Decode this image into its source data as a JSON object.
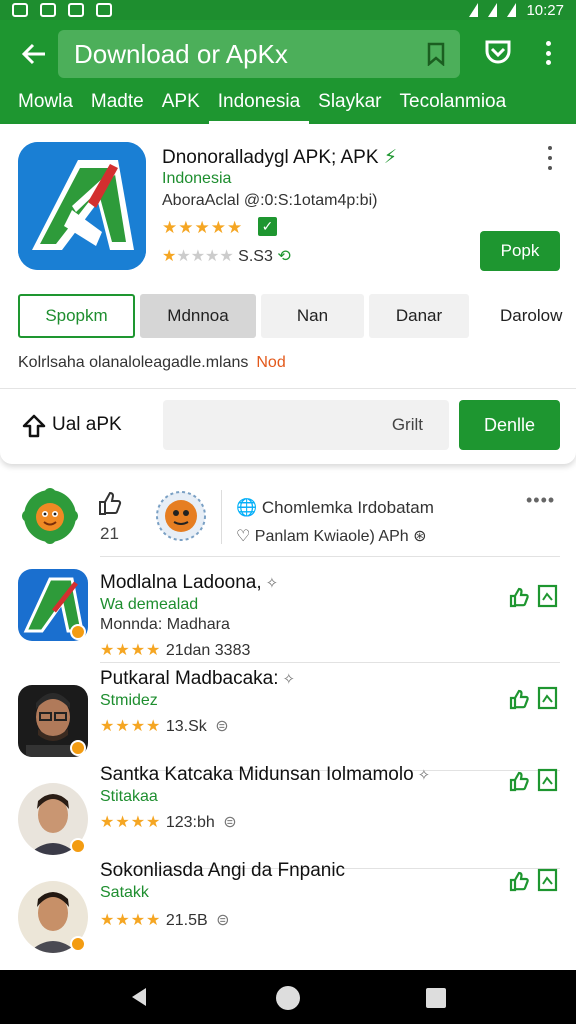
{
  "status_bar": {
    "time": "10:27"
  },
  "app_bar": {
    "search_text": "Download or ApKx",
    "tabs": [
      "Mowla",
      "Madte",
      "APK",
      "Indonesia",
      "Slaykar",
      "Tecolanmioa"
    ],
    "active_tab": 3
  },
  "featured": {
    "title": "Dnonoralladygl APK; APK",
    "subtitle": "Indonesia",
    "developer": "AboraAclal @:0:S:1otam4p:bi)",
    "rating_count": "S.S3",
    "install_label": "Popk",
    "chips": [
      "Spopkm",
      "Mdnnoa",
      "Nan",
      "Danar",
      "Darolow"
    ],
    "info_text": "Kolrlsaha olanaloleagadle.mlans",
    "info_new": "Nod",
    "share_label": "Ual aPK",
    "comment_placeholder": "Grilt",
    "done_label": "Denlle",
    "colors": {
      "accent": "#1e9630",
      "star": "#f5a623",
      "new_tag": "#e3591b"
    }
  },
  "news": {
    "count": "21",
    "title": "Chomlemka Irdobatam",
    "subtitle": "Panlam Kwiaole) APh"
  },
  "list": [
    {
      "name": "Modlalna Ladoona,",
      "role": "Wa demealad",
      "desc": "Monnda: Madhara",
      "meta": "21dan 3383",
      "icon": "app-icon"
    },
    {
      "name": "Putkaral Madbacaka:",
      "role": "Stmidez",
      "meta": "13.Sk",
      "icon": "person-glasses"
    },
    {
      "name": "Santka Katcaka Midunsan Iolmamolo",
      "role": "Stitakaa",
      "meta": "123:bh",
      "icon": "person"
    },
    {
      "name": "Sokonliasda Angi da Fnpanic",
      "role": "Satakk",
      "meta": "21.5B",
      "icon": "person"
    }
  ]
}
